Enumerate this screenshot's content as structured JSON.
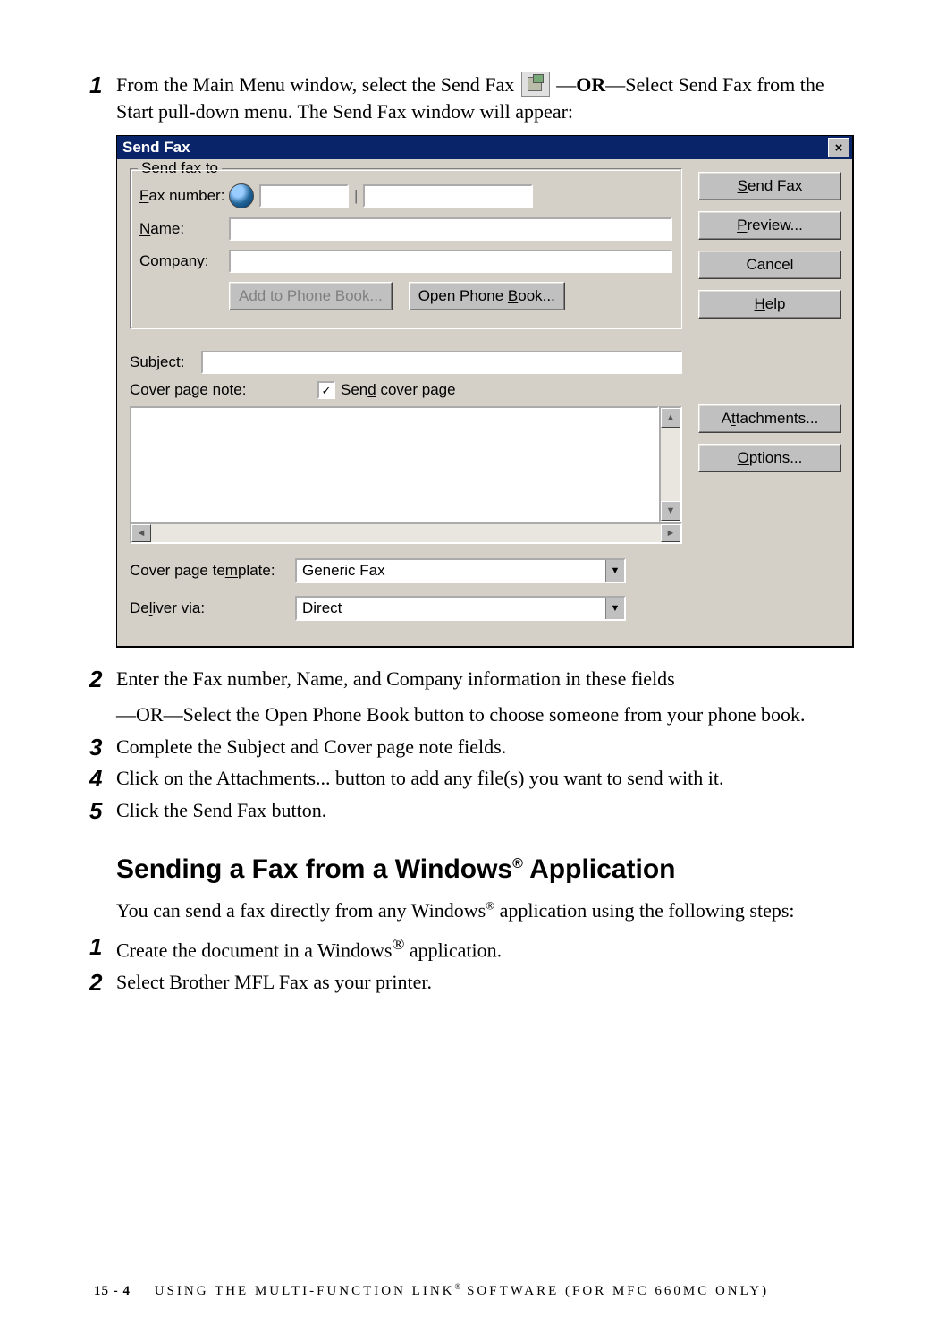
{
  "step1": {
    "text_prefix": "From the Main Menu window, select the Send Fax ",
    "text_or": "OR",
    "text_suffix1": "—Select Send Fax from the Start pull-down menu.  The Send Fax window will appear:"
  },
  "dialog": {
    "title": "Send Fax",
    "close_glyph": "×",
    "fieldset_legend": "Send fax to",
    "fax_number_label": "Fax number:",
    "fax_number_label_u": "F",
    "name_label": "Name:",
    "name_label_u": "N",
    "company_label": "Company:",
    "company_label_u": "C",
    "add_phone_book": "Add to Phone Book...",
    "open_phone_book": "Open Phone Book...",
    "open_phone_book_u": "B",
    "send_fax_btn": "Send Fax",
    "send_fax_btn_u": "S",
    "preview_btn": "Preview...",
    "preview_btn_u": "P",
    "cancel_btn": "Cancel",
    "help_btn": "Help",
    "help_btn_u": "H",
    "subject_label": "Subject:",
    "cover_note_label": "Cover page note:",
    "send_cover_label": "Send cover page",
    "send_cover_u": "d",
    "attachments_btn": "Attachments...",
    "attachments_btn_u": "t",
    "options_btn": "Options...",
    "options_btn_u": "O",
    "template_label": "Cover page template:",
    "template_label_u": "m",
    "template_value": "Generic Fax",
    "deliver_label": "Deliver via:",
    "deliver_label_u": "l",
    "deliver_value": "Direct",
    "checkbox_mark": "✓"
  },
  "step2": {
    "line": "Enter the Fax number, Name, and Company information in these fields",
    "or_prefix": "—",
    "or": "OR",
    "or_text": "—Select the Open Phone Book button to choose someone from your phone book."
  },
  "step3": {
    "line": "Complete the Subject and Cover page note fields."
  },
  "step4": {
    "line": "Click on the Attachments... button to add any file(s) you want to send with it."
  },
  "step5": {
    "line": "Click the Send Fax button."
  },
  "section": {
    "heading_a": "Sending a Fax from a Windows",
    "heading_b": " Application",
    "para_a": "You can send a fax directly from any Windows",
    "para_b": " application using the following steps:"
  },
  "step_b1": {
    "line_a": "Create the document in a Windows",
    "line_b": " application."
  },
  "step_b2": {
    "line": "Select Brother MFL Fax as your printer."
  },
  "footer": {
    "page": "15 - 4",
    "text_a": "USING THE MULTI-FUNCTION LINK",
    "text_b": " SOFTWARE (FOR MFC 660MC ONLY)"
  }
}
